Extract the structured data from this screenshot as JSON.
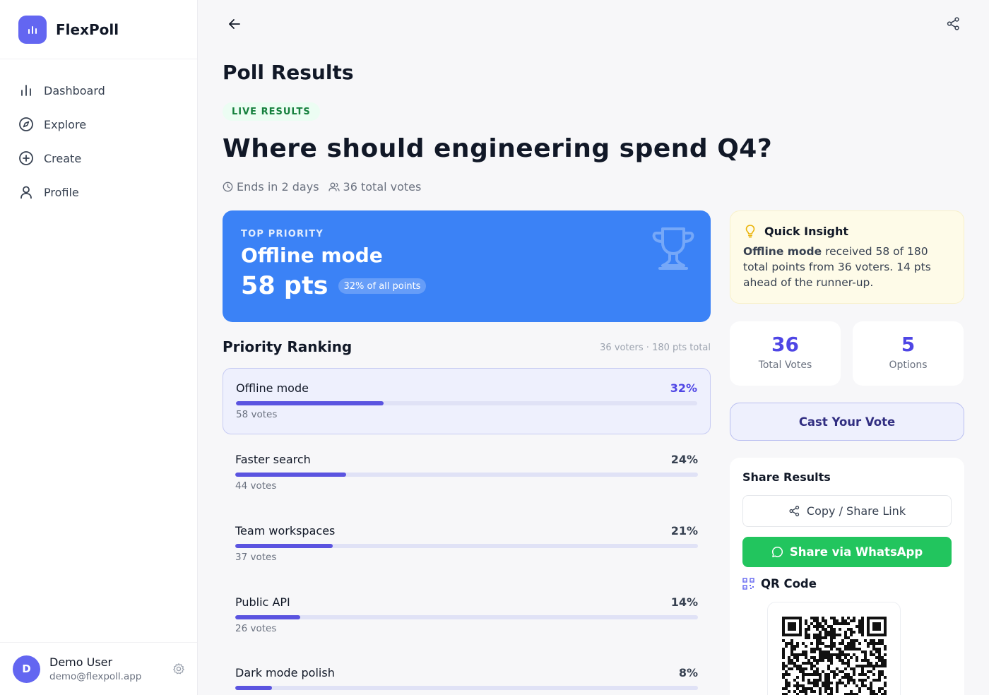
{
  "app": {
    "name": "FlexPoll"
  },
  "nav": {
    "items": [
      {
        "label": "Dashboard",
        "icon": "bar-chart-icon"
      },
      {
        "label": "Explore",
        "icon": "compass-icon"
      },
      {
        "label": "Create",
        "icon": "plus-circle-icon"
      },
      {
        "label": "Profile",
        "icon": "user-icon"
      }
    ]
  },
  "user": {
    "initial": "D",
    "name": "Demo User",
    "email": "demo@flexpoll.app"
  },
  "page": {
    "title": "Poll Results",
    "badge": "LIVE RESULTS",
    "question": "Where should engineering spend Q4?",
    "ends": "Ends in 2 days",
    "votes": "36 total votes"
  },
  "top": {
    "label": "TOP PRIORITY",
    "name": "Offline mode",
    "pts": "58 pts",
    "share": "32% of all points"
  },
  "ranking": {
    "title": "Priority Ranking",
    "meta": "36 voters · 180 pts total",
    "items": [
      {
        "name": "Offline mode",
        "pct": "32%",
        "share": 0.32,
        "votes": "58 votes"
      },
      {
        "name": "Faster search",
        "pct": "24%",
        "share": 0.24,
        "votes": "44 votes"
      },
      {
        "name": "Team workspaces",
        "pct": "21%",
        "share": 0.21,
        "votes": "37 votes"
      },
      {
        "name": "Public API",
        "pct": "14%",
        "share": 0.14,
        "votes": "26 votes"
      },
      {
        "name": "Dark mode polish",
        "pct": "8%",
        "share": 0.08,
        "votes": ""
      }
    ]
  },
  "insight": {
    "title": "Quick Insight",
    "bold": "Offline mode",
    "text": " received 58 of 180 total points from 36 voters. 14 pts ahead of the runner-up."
  },
  "stats": [
    {
      "value": "36",
      "label": "Total Votes"
    },
    {
      "value": "5",
      "label": "Options"
    }
  ],
  "cast": {
    "label": "Cast Your Vote"
  },
  "share": {
    "title": "Share Results",
    "copy": "Copy / Share Link",
    "whatsapp": "Share via WhatsApp",
    "qr": "QR Code"
  },
  "colors": {
    "accent": "#6366f1",
    "banner": "#3b82f6",
    "whatsapp": "#22c55e",
    "live": "#15803d"
  }
}
